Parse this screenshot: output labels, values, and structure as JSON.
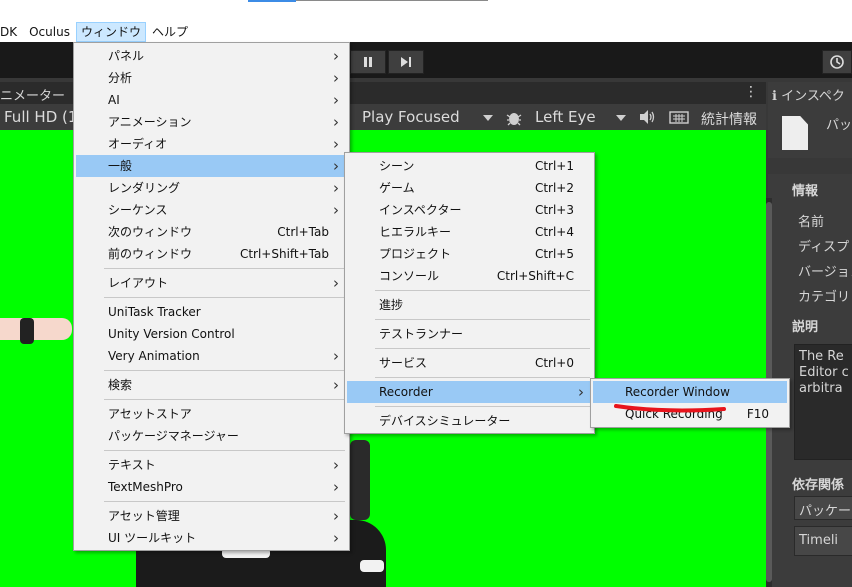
{
  "menubar": {
    "items": [
      {
        "label": "DK"
      },
      {
        "label": "Oculus"
      },
      {
        "label": "ウィンドウ"
      },
      {
        "label": "ヘルプ"
      }
    ]
  },
  "game_view": {
    "title": "ニメーター",
    "resolution": "Full HD (1",
    "play_mode": "Play Focused",
    "eye": "Left Eye",
    "stats": "統計情報"
  },
  "inspector": {
    "tab": "インスペク",
    "package": "パッケ",
    "info_title": "情報",
    "info_rows": [
      "名前",
      "ディスプレ",
      "バージョン",
      "カテゴリ"
    ],
    "desc_title": "説明",
    "desc_lines": [
      "The Re",
      "Editor c",
      "arbitra"
    ],
    "deps_title": "依存関係",
    "deps_fields": [
      "パッケー",
      "Timeli"
    ]
  },
  "window_menu": {
    "items": [
      {
        "label": "パネル",
        "sub": true
      },
      {
        "label": "分析",
        "sub": true
      },
      {
        "label": "AI",
        "sub": true
      },
      {
        "label": "アニメーション",
        "sub": true
      },
      {
        "label": "オーディオ",
        "sub": true
      },
      {
        "label": "一般",
        "sub": true,
        "highlight": true
      },
      {
        "label": "レンダリング",
        "sub": true
      },
      {
        "label": "シーケンス",
        "sub": true
      },
      {
        "label": "次のウィンドウ",
        "shortcut": "Ctrl+Tab"
      },
      {
        "label": "前のウィンドウ",
        "shortcut": "Ctrl+Shift+Tab"
      },
      {
        "label": "レイアウト",
        "sub": true
      },
      {
        "label": "UniTask Tracker"
      },
      {
        "label": "Unity Version Control"
      },
      {
        "label": "Very Animation",
        "sub": true
      },
      {
        "label": "検索",
        "sub": true
      },
      {
        "label": "アセットストア"
      },
      {
        "label": "パッケージマネージャー"
      },
      {
        "label": "テキスト",
        "sub": true
      },
      {
        "label": "TextMeshPro",
        "sub": true
      },
      {
        "label": "アセット管理",
        "sub": true
      },
      {
        "label": "UI ツールキット",
        "sub": true
      }
    ]
  },
  "general_menu": {
    "items": [
      {
        "label": "シーン",
        "shortcut": "Ctrl+1"
      },
      {
        "label": "ゲーム",
        "shortcut": "Ctrl+2"
      },
      {
        "label": "インスペクター",
        "shortcut": "Ctrl+3"
      },
      {
        "label": "ヒエラルキー",
        "shortcut": "Ctrl+4"
      },
      {
        "label": "プロジェクト",
        "shortcut": "Ctrl+5"
      },
      {
        "label": "コンソール",
        "shortcut": "Ctrl+Shift+C"
      },
      {
        "label": "進捗"
      },
      {
        "label": "テストランナー"
      },
      {
        "label": "サービス",
        "shortcut": "Ctrl+0"
      },
      {
        "label": "Recorder",
        "sub": true,
        "highlight": true
      },
      {
        "label": "デバイスシミュレーター"
      }
    ]
  },
  "recorder_menu": {
    "items": [
      {
        "label": "Recorder Window",
        "highlight": true
      },
      {
        "label": "Quick Recording",
        "shortcut": "F10"
      }
    ]
  },
  "colors": {
    "green_screen": "#00ff00",
    "highlight": "#99c9f5",
    "annotation": "#e8141c"
  }
}
